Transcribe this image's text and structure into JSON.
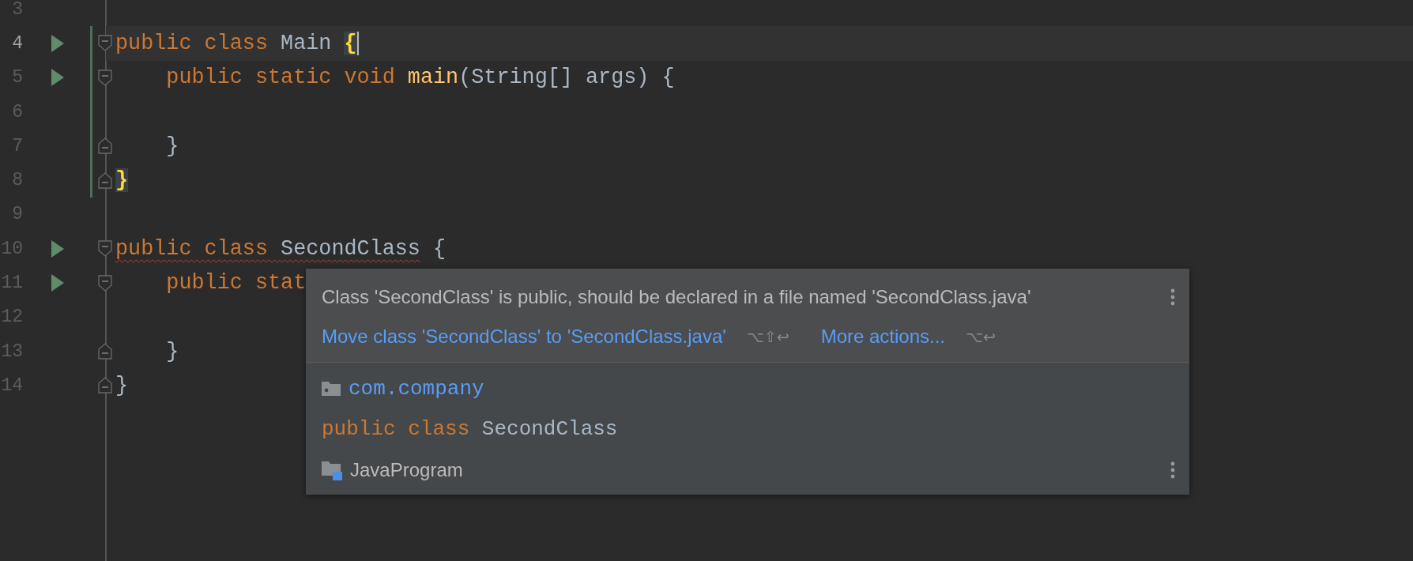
{
  "editor": {
    "lines": [
      {
        "number": "3",
        "current": false,
        "run": false,
        "changed": false,
        "fold_open": false,
        "fold_close": false
      },
      {
        "number": "4",
        "current": true,
        "run": true,
        "changed": true,
        "fold_open": true,
        "fold_close": false,
        "tokens": [
          {
            "text": "public class ",
            "kind": "keyword",
            "underlined": false
          },
          {
            "text": "Main ",
            "kind": "plain",
            "underlined": false
          },
          {
            "text": "{",
            "kind": "brace_match",
            "underlined": false
          }
        ]
      },
      {
        "number": "5",
        "current": false,
        "run": true,
        "changed": true,
        "fold_open": true,
        "fold_close": false,
        "tokens": [
          {
            "text": "    public static void ",
            "kind": "keyword",
            "underlined": false
          },
          {
            "text": "main",
            "kind": "method",
            "underlined": false
          },
          {
            "text": "(String[] args) {",
            "kind": "plain",
            "underlined": false
          }
        ]
      },
      {
        "number": "6",
        "current": false,
        "run": false,
        "changed": true,
        "fold_open": false,
        "fold_close": false
      },
      {
        "number": "7",
        "current": false,
        "run": false,
        "changed": true,
        "fold_open": false,
        "fold_close": true,
        "tokens": [
          {
            "text": "    }",
            "kind": "plain",
            "underlined": false
          }
        ]
      },
      {
        "number": "8",
        "current": false,
        "run": false,
        "changed": true,
        "fold_open": false,
        "fold_close": true,
        "tokens": [
          {
            "text": "}",
            "kind": "brace_match",
            "underlined": false
          }
        ]
      },
      {
        "number": "9",
        "current": false,
        "run": false,
        "changed": false,
        "fold_open": false,
        "fold_close": false
      },
      {
        "number": "10",
        "current": false,
        "run": true,
        "changed": false,
        "fold_open": true,
        "fold_close": false,
        "tokens": [
          {
            "text": "public class ",
            "kind": "keyword",
            "underlined": true
          },
          {
            "text": "SecondClass",
            "kind": "plain",
            "underlined": true
          },
          {
            "text": " {",
            "kind": "plain",
            "underlined": false
          }
        ]
      },
      {
        "number": "11",
        "current": false,
        "run": true,
        "changed": false,
        "fold_open": true,
        "fold_close": false,
        "tokens": [
          {
            "text": "    public stat",
            "kind": "keyword",
            "underlined": false
          }
        ]
      },
      {
        "number": "12",
        "current": false,
        "run": false,
        "changed": false,
        "fold_open": false,
        "fold_close": false
      },
      {
        "number": "13",
        "current": false,
        "run": false,
        "changed": false,
        "fold_open": false,
        "fold_close": true,
        "tokens": [
          {
            "text": "    }",
            "kind": "plain",
            "underlined": false
          }
        ]
      },
      {
        "number": "14",
        "current": false,
        "run": false,
        "changed": false,
        "fold_open": false,
        "fold_close": true,
        "tokens": [
          {
            "text": "}",
            "kind": "plain",
            "underlined": false
          }
        ]
      }
    ]
  },
  "popup": {
    "message": "Class 'SecondClass' is public, should be declared in a file named 'SecondClass.java'",
    "actions": [
      {
        "label": "Move class 'SecondClass' to 'SecondClass.java'",
        "shortcut": "⌥⇧↩"
      },
      {
        "label": "More actions...",
        "shortcut": "⌥↩"
      }
    ],
    "package": "com.company",
    "declaration": [
      {
        "text": "public class ",
        "kind": "keyword"
      },
      {
        "text": "SecondClass",
        "kind": "plain"
      }
    ],
    "module": "JavaProgram"
  }
}
